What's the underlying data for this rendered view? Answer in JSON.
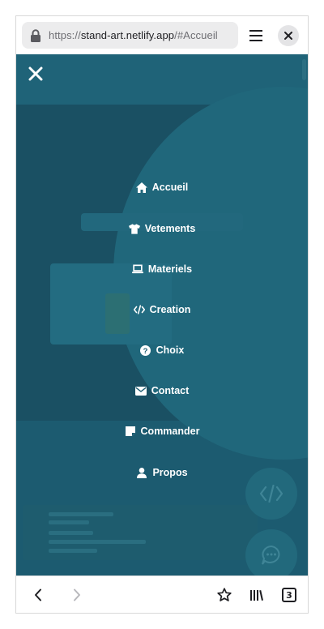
{
  "browser": {
    "url_scheme": "https://",
    "url_host": "stand-art.netlify.app",
    "url_path": "/#Accueil",
    "tab_count": "3"
  },
  "menu": {
    "items": [
      {
        "label": "Accueil",
        "icon": "home-icon"
      },
      {
        "label": "Vetements",
        "icon": "shirt-icon"
      },
      {
        "label": "Materiels",
        "icon": "laptop-icon"
      },
      {
        "label": "Creation",
        "icon": "code-icon"
      },
      {
        "label": "Choix",
        "icon": "question-icon"
      },
      {
        "label": "Contact",
        "icon": "envelope-icon"
      },
      {
        "label": "Commander",
        "icon": "note-icon"
      },
      {
        "label": "Propos",
        "icon": "user-icon"
      }
    ]
  },
  "colors": {
    "overlay": "#1c5b70",
    "text": "#ffffff",
    "fab": "#22697c"
  }
}
